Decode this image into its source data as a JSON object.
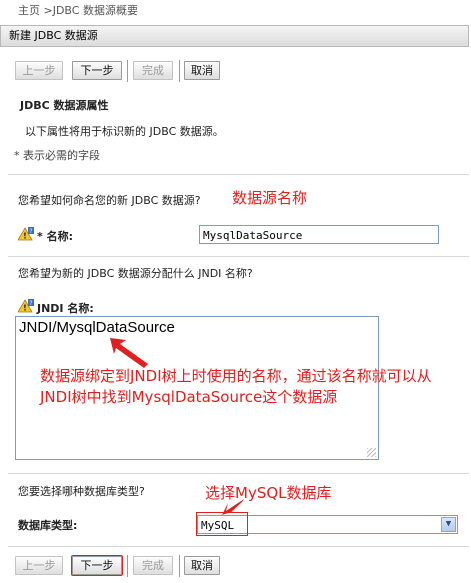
{
  "breadcrumb": "主页 >JDBC 数据源概要",
  "title": "新建 JDBC 数据源",
  "buttons": {
    "back": "上一步",
    "next": "下一步",
    "finish": "完成",
    "cancel": "取消"
  },
  "section_title": "JDBC 数据源属性",
  "section_desc": "以下属性将用于标识新的 JDBC 数据源。",
  "required_note": "* 表示必需的字段",
  "name_question": "您希望如何命名您的新 JDBC 数据源?",
  "name_label": "* 名称:",
  "name_value": "MysqlDataSource",
  "jndi_question": "您希望为新的 JDBC 数据源分配什么 JNDI 名称?",
  "jndi_label": "JNDI 名称:",
  "jndi_value": "JNDI/MysqlDataSource",
  "dbtype_question": "您要选择哪种数据库类型?",
  "dbtype_label": "数据库类型:",
  "dbtype_value": "MySQL",
  "annotations": {
    "name": "数据源名称",
    "jndi_line1": "数据源绑定到JNDI树上时使用的名称，通过该名称就可以从",
    "jndi_line2": "JNDI树中找到MysqlDataSource这个数据源",
    "mysql": "选择MySQL数据库"
  },
  "colors": {
    "annotation": "#e02020",
    "panel_border": "#b8b8b8"
  },
  "icons": {
    "help": "help-warning-icon",
    "dropdown": "chevron-down-icon"
  }
}
